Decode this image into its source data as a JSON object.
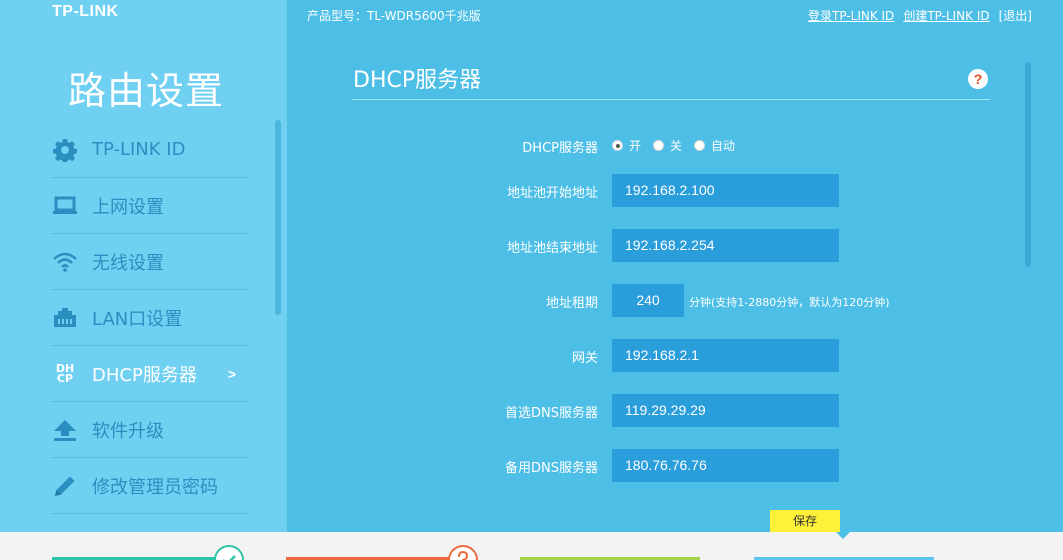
{
  "brand": {
    "logo": "TP-LINK"
  },
  "sidebar": {
    "title": "路由设置",
    "items": [
      {
        "label": "TP-LINK ID",
        "icon": "gear-icon"
      },
      {
        "label": "上网设置",
        "icon": "laptop-icon"
      },
      {
        "label": "无线设置",
        "icon": "wifi-icon"
      },
      {
        "label": "LAN口设置",
        "icon": "lan-port-icon"
      },
      {
        "label": "DHCP服务器",
        "icon": "dhcp-icon",
        "active": true,
        "arrow": ">"
      },
      {
        "label": "软件升级",
        "icon": "upload-icon"
      },
      {
        "label": "修改管理员密码",
        "icon": "pencil-icon"
      }
    ],
    "dhcp_icon_text": [
      "DH",
      "CP"
    ]
  },
  "header": {
    "model": "产品型号：TL-WDR5600千兆版",
    "links": {
      "login": "登录TP-LINK ID",
      "create": "创建TP-LINK ID",
      "logout": "[退出]"
    }
  },
  "main": {
    "title": "DHCP服务器",
    "help": "?",
    "dhcp_label": "DHCP服务器",
    "dhcp_options": {
      "on": "开",
      "off": "关",
      "auto": "自动"
    },
    "dhcp_selected": "开",
    "fields": {
      "pool_start": {
        "label": "地址池开始地址",
        "value": "192.168.2.100"
      },
      "pool_end": {
        "label": "地址池结束地址",
        "value": "192.168.2.254"
      },
      "lease": {
        "label": "地址租期",
        "value": "240",
        "hint": "分钟(支持1-2880分钟，默认为120分钟)"
      },
      "gateway": {
        "label": "网关",
        "value": "192.168.2.1"
      },
      "dns_primary": {
        "label": "首选DNS服务器",
        "value": "119.29.29.29"
      },
      "dns_secondary": {
        "label": "备用DNS服务器",
        "value": "180.76.76.76"
      }
    },
    "save_label": "保存"
  },
  "colors": {
    "main_bg": "#4dbfe6",
    "sidebar_bg": "#6fd0f2",
    "field_bg": "#2a9ddb",
    "save_bg": "#fff03a"
  }
}
